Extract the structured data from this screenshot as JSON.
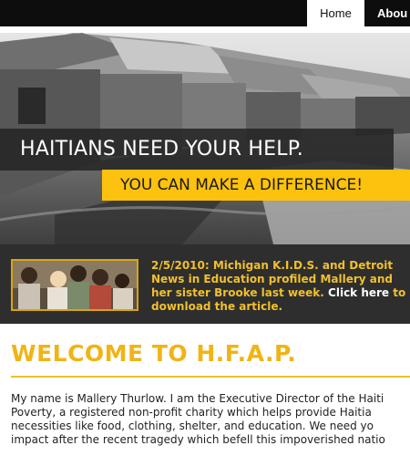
{
  "nav": {
    "tabs": [
      {
        "label": "Home",
        "active": true
      },
      {
        "label": "Abou",
        "active": false
      }
    ]
  },
  "hero": {
    "headline": "HAITIANS NEED YOUR HELP.",
    "subheadline": "YOU CAN MAKE A DIFFERENCE!",
    "image": "shanty-town-photo"
  },
  "news": {
    "text": "2/5/2010: Michigan K.I.D.S. and Detroit News in Education profiled Mallery and her sister Brooke last week.",
    "link_label": "Click here",
    "link_tail": "to download the article.",
    "photo": "children-group-photo"
  },
  "welcome": {
    "title": "WELCOME TO H.F.A.P.",
    "lines": [
      "My name is Mallery Thurlow. I am the Executive Director of the Haiti",
      "Poverty, a registered non-profit charity which helps provide Haitia",
      "necessities like food, clothing, shelter, and education. We need yo",
      "impact after the recent tragedy which befell this impoverished natio"
    ]
  },
  "colors": {
    "accent": "#fdc20d",
    "title": "#f0b415",
    "dark": "#2e2e2e"
  }
}
